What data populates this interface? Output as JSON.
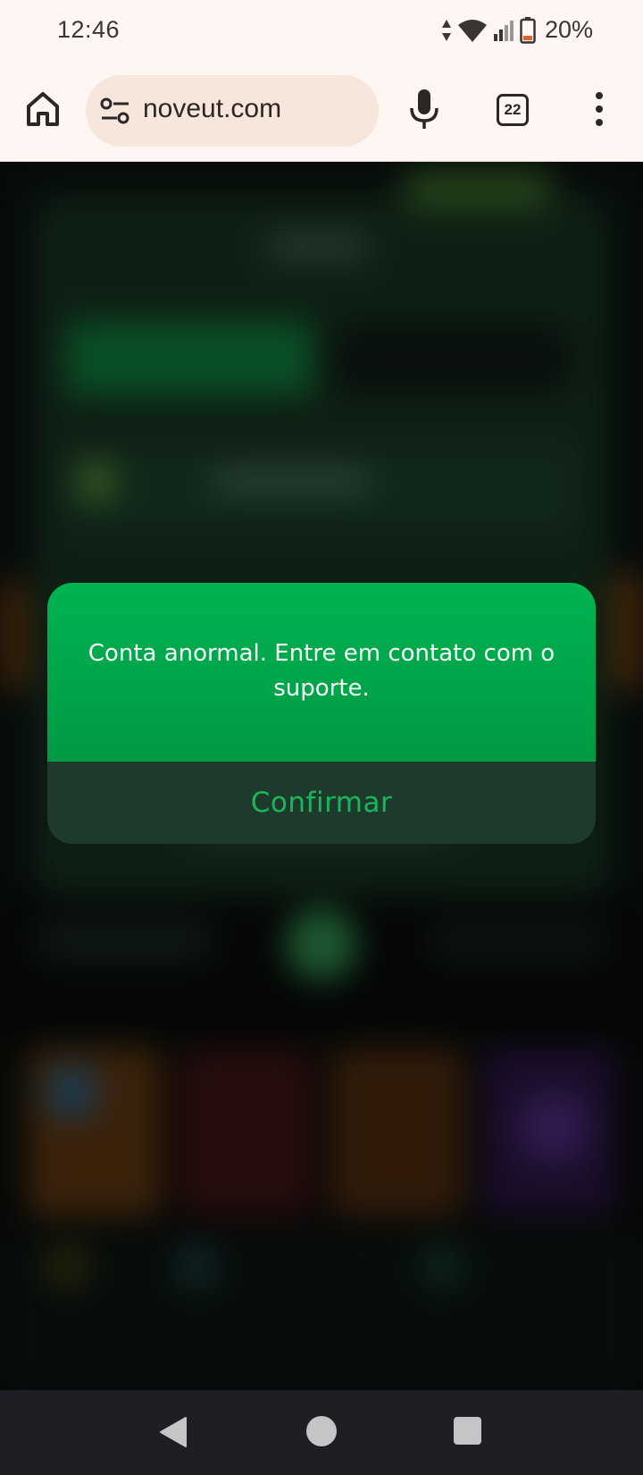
{
  "status_bar": {
    "time": "12:46",
    "battery_percent": "20%",
    "battery_level": 0.2,
    "icons": [
      "data-arrows-icon",
      "wifi-icon",
      "signal-icon",
      "battery-icon"
    ]
  },
  "browser": {
    "url": "noveut.com",
    "tab_count": "22",
    "icons": [
      "home-icon",
      "site-settings-icon",
      "mic-icon",
      "more-vert-icon"
    ]
  },
  "dialog": {
    "message": "Conta anormal. Entre em contato com o suporte.",
    "confirm_label": "Confirmar",
    "colors": {
      "header_top": "#00b351",
      "header_bottom": "#009a44",
      "footer": "#1e3a2c",
      "confirm_text": "#18b85a"
    }
  },
  "nav_bar": {
    "icons": [
      "back-icon",
      "home-circle-icon",
      "recents-icon"
    ]
  }
}
